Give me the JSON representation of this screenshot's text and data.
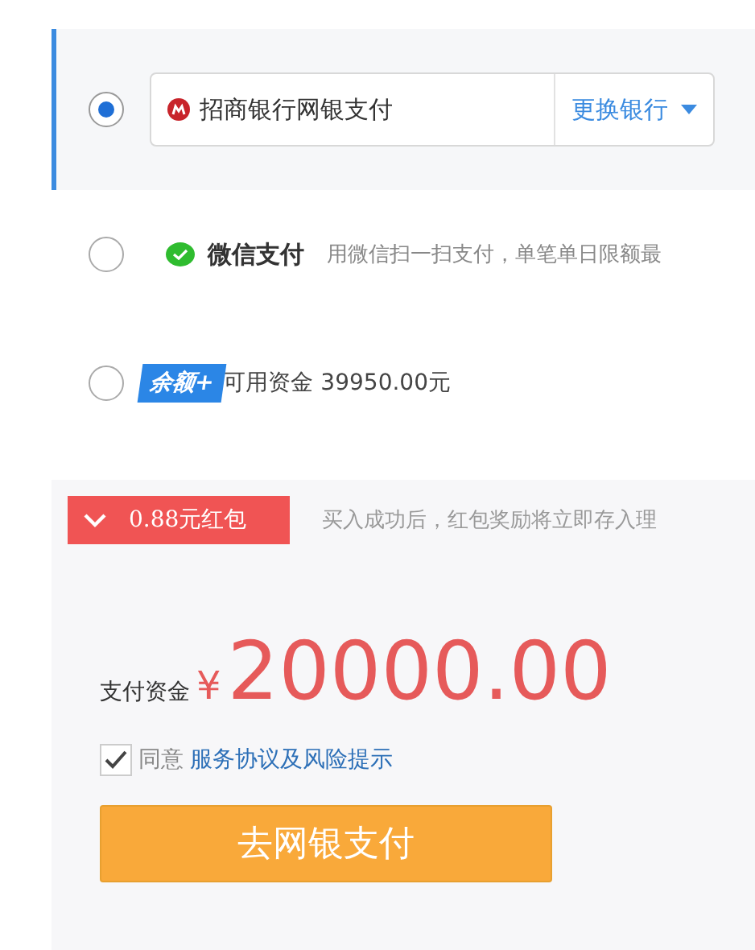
{
  "payment_methods": [
    {
      "kind": "bank",
      "selected": true,
      "bank_name": "招商银行网银支付",
      "action": "更换银行"
    },
    {
      "kind": "wechat",
      "selected": false,
      "label": "微信支付",
      "description": "用微信扫一扫支付，单笔单日限额最"
    },
    {
      "kind": "balance",
      "selected": false,
      "badge": "余额+",
      "text": "可用资金 39950.00元"
    }
  ],
  "bonus": {
    "checked": true,
    "label": "0.88元红包",
    "description": "买入成功后，红包奖励将立即存入理"
  },
  "amount": {
    "label": "支付资金",
    "currency": "¥",
    "value": "20000.00"
  },
  "agreement": {
    "checked": true,
    "text": "同意",
    "link": "服务协议及风险提示"
  },
  "submit": {
    "label": "去网银支付"
  }
}
